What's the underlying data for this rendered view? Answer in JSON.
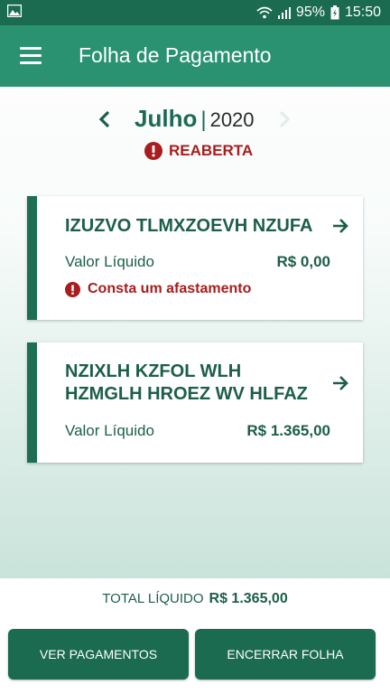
{
  "status_bar": {
    "battery": "95%",
    "time": "15:50"
  },
  "app_bar": {
    "title": "Folha de Pagamento"
  },
  "period": {
    "month": "Julho",
    "separator": "|",
    "year": "2020",
    "status": "REABERTA"
  },
  "cards": [
    {
      "name": "IZUZVO TLMXZOEVH NZUFA",
      "label": "Valor Líquido",
      "amount": "R$ 0,00",
      "warning": "Consta um afastamento"
    },
    {
      "name": "NZIXLH KZFOL WLH HZMGLH HROEZ WV HLFAZ",
      "label": "Valor Líquido",
      "amount": "R$ 1.365,00"
    }
  ],
  "footer": {
    "total_label": "TOTAL LÍQUIDO",
    "total_value": "R$ 1.365,00",
    "left_button": "VER PAGAMENTOS",
    "right_button": "ENCERRAR FOLHA"
  },
  "colors": {
    "primary": "#1b6b51",
    "app_bar": "#2a9271",
    "alert": "#a81d1d"
  }
}
